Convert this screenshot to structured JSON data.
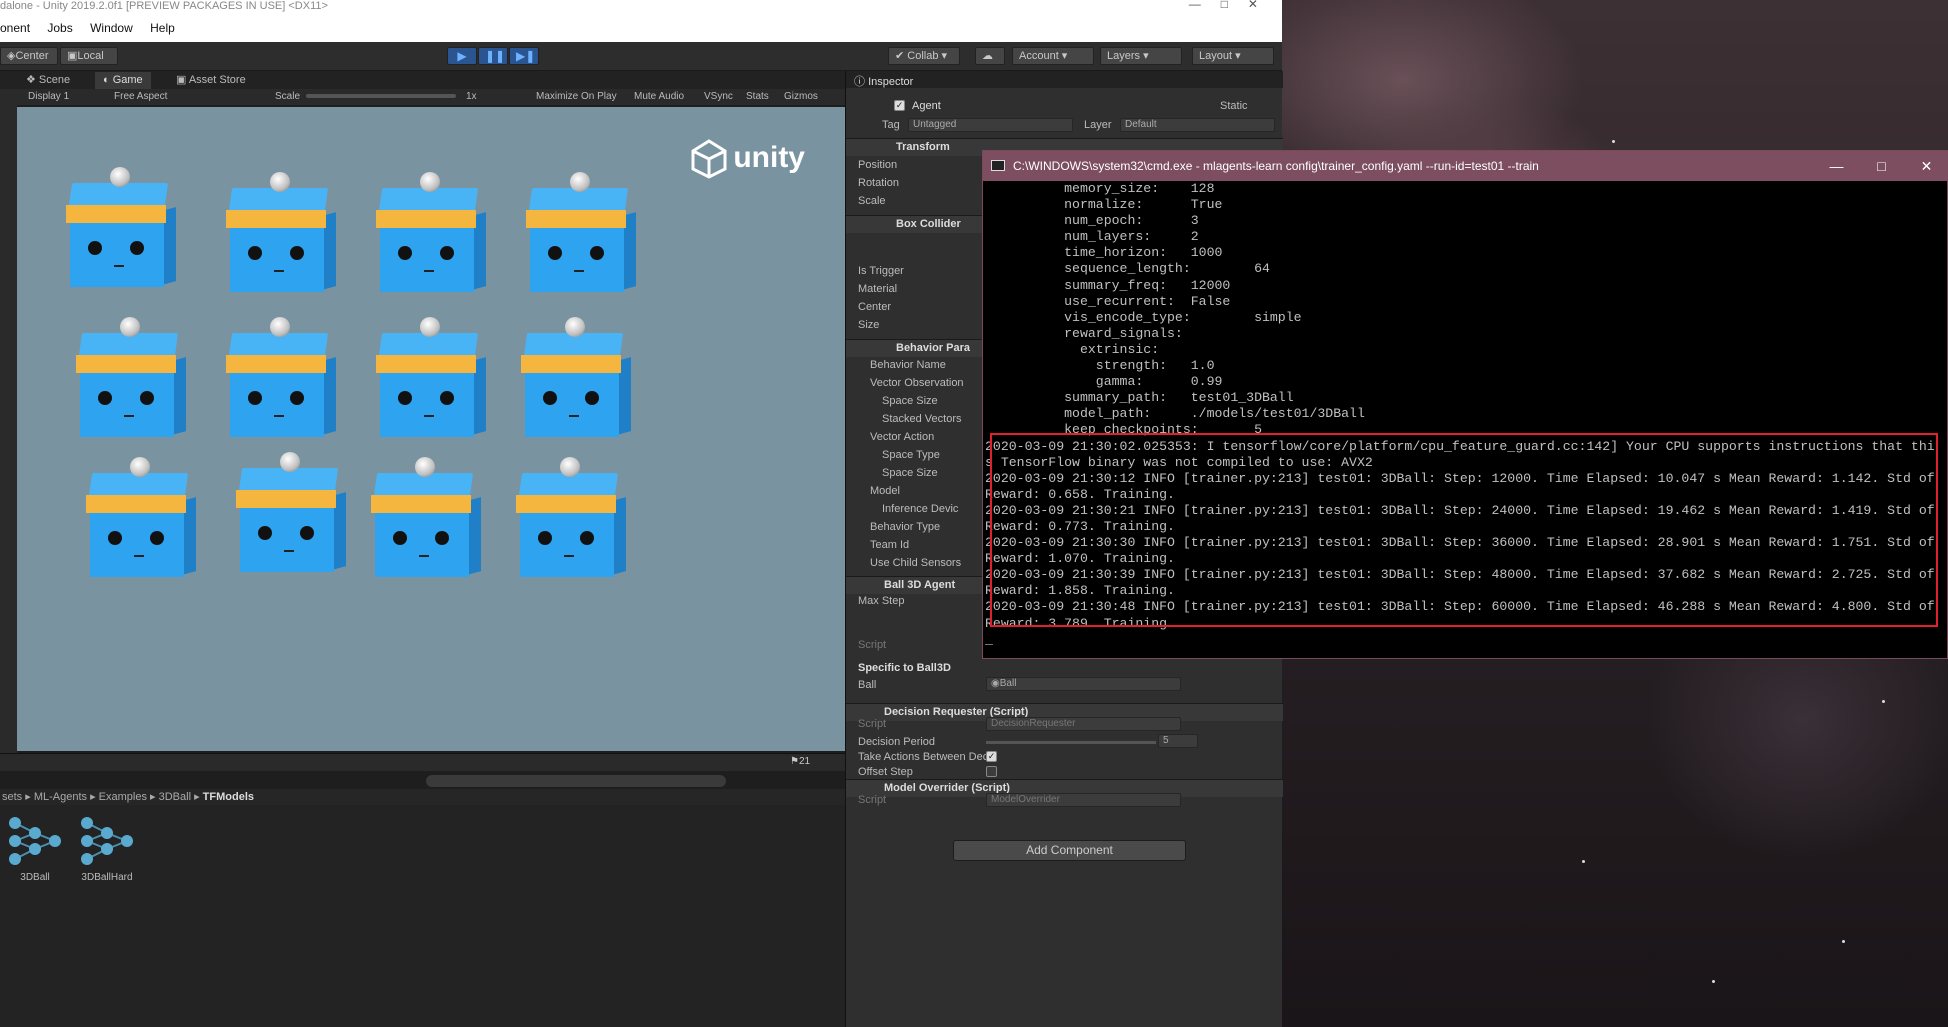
{
  "title_bar": {
    "text": "dalone - Unity 2019.2.0f1 [PREVIEW PACKAGES IN USE] <DX11>"
  },
  "menu": [
    "onent",
    "Jobs",
    "Window",
    "Help"
  ],
  "toolbar": {
    "center": "Center",
    "local": "Local",
    "collab": "Collab",
    "account": "Account",
    "layers": "Layers",
    "layout": "Layout"
  },
  "view_tabs": [
    {
      "label": "Scene"
    },
    {
      "label": "Game"
    },
    {
      "label": "Asset Store"
    }
  ],
  "game_bar": {
    "display": "Display 1",
    "aspect": "Free Aspect",
    "scale": "Scale",
    "scale_value": "1x",
    "maximize": "Maximize On Play",
    "mute": "Mute Audio",
    "vsync": "VSync",
    "stats": "Stats",
    "gizmos": "Gizmos"
  },
  "logo_text": "unity",
  "project": {
    "breadcrumbs": [
      "sets",
      "ML-Agents",
      "Examples",
      "3DBall"
    ],
    "current": "TFModels",
    "count": "21",
    "assets": [
      {
        "name": "3DBall"
      },
      {
        "name": "3DBallHard"
      }
    ]
  },
  "inspector": {
    "tab": "Inspector",
    "object_name": "Agent",
    "static": "Static",
    "tag_label": "Tag",
    "tag_value": "Untagged",
    "layer_label": "Layer",
    "layer_value": "Default",
    "transform": {
      "title": "Transform",
      "fields": [
        "Position",
        "Rotation",
        "Scale"
      ]
    },
    "box_collider": {
      "title": "Box Collider",
      "fields": [
        "Is Trigger",
        "Material",
        "Center",
        "Size"
      ]
    },
    "behavior": {
      "title": "Behavior Para",
      "fields": [
        "Behavior Name",
        "Vector Observation",
        "Space Size",
        "Stacked Vectors",
        "Vector Action",
        "Space Type",
        "Space Size",
        "Model",
        "Inference Devic",
        "Behavior Type",
        "Team Id",
        "Use Child Sensors"
      ]
    },
    "ball_agent": {
      "title": "Ball 3D Agent",
      "max_step": "Max Step",
      "script": "Script"
    },
    "specific": {
      "title": "Specific to Ball3D",
      "ball_label": "Ball",
      "ball_value": "Ball"
    },
    "decision": {
      "title": "Decision Requester (Script)",
      "script_label": "Script",
      "script_value": "DecisionRequester",
      "period_label": "Decision Period",
      "period_value": "5",
      "take_actions": "Take Actions Between Decis",
      "offset": "Offset Step"
    },
    "override": {
      "title": "Model Overrider (Script)",
      "script_label": "Script",
      "script_value": "ModelOverrider"
    },
    "add_component": "Add Component"
  },
  "cmd": {
    "title": "C:\\WINDOWS\\system32\\cmd.exe - mlagents-learn  config\\trainer_config.yaml --run-id=test01 --train",
    "lines": [
      "          memory_size:    128",
      "          normalize:      True",
      "          num_epoch:      3",
      "          num_layers:     2",
      "          time_horizon:   1000",
      "          sequence_length:        64",
      "          summary_freq:   12000",
      "          use_recurrent:  False",
      "          vis_encode_type:        simple",
      "          reward_signals:",
      "            extrinsic:",
      "              strength:   1.0",
      "              gamma:      0.99",
      "          summary_path:   test01_3DBall",
      "          model_path:     ./models/test01/3DBall",
      "          keep_checkpoints:       5",
      "2020-03-09 21:30:02.025353: I tensorflow/core/platform/cpu_feature_guard.cc:142] Your CPU supports instructions that thi",
      "s TensorFlow binary was not compiled to use: AVX2",
      "2020-03-09 21:30:12 INFO [trainer.py:213] test01: 3DBall: Step: 12000. Time Elapsed: 10.047 s Mean Reward: 1.142. Std of",
      "Reward: 0.658. Training.",
      "2020-03-09 21:30:21 INFO [trainer.py:213] test01: 3DBall: Step: 24000. Time Elapsed: 19.462 s Mean Reward: 1.419. Std of",
      "Reward: 0.773. Training.",
      "2020-03-09 21:30:30 INFO [trainer.py:213] test01: 3DBall: Step: 36000. Time Elapsed: 28.901 s Mean Reward: 1.751. Std of",
      "Reward: 1.070. Training.",
      "2020-03-09 21:30:39 INFO [trainer.py:213] test01: 3DBall: Step: 48000. Time Elapsed: 37.682 s Mean Reward: 2.725. Std of",
      "Reward: 1.858. Training.",
      "2020-03-09 21:30:48 INFO [trainer.py:213] test01: 3DBall: Step: 60000. Time Elapsed: 46.288 s Mean Reward: 4.800. Std of",
      "Reward: 3.789. Training.",
      "_"
    ]
  },
  "colors": {
    "accent": "#3d8bd6",
    "highlight": "#e0202a",
    "cmd_title": "#7d4e60"
  }
}
